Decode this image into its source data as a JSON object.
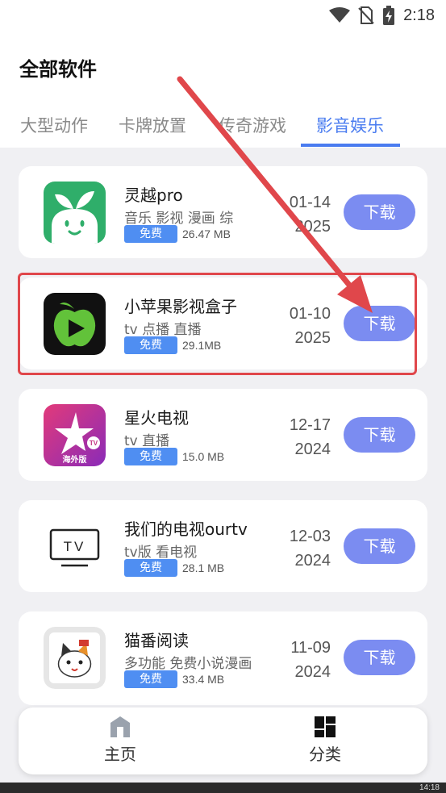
{
  "status_bar": {
    "time": "2:18"
  },
  "page": {
    "title": "全部软件"
  },
  "tabs": [
    {
      "label": "大型动作",
      "active": false
    },
    {
      "label": "卡牌放置",
      "active": false
    },
    {
      "label": "传奇游戏",
      "active": false
    },
    {
      "label": "影音娱乐",
      "active": true
    }
  ],
  "apps": [
    {
      "name": "灵越pro",
      "tags": "音乐 影视 漫画 综",
      "badge": "免费",
      "size": "26.47 MB",
      "date_top": "01-14",
      "date_bottom": "2025",
      "button": "下载",
      "icon": "leaf-face-icon"
    },
    {
      "name": "小苹果影视盒子",
      "tags": "tv 点播 直播",
      "badge": "免费",
      "size": "29.1MB",
      "date_top": "01-10",
      "date_bottom": "2025",
      "button": "下载",
      "icon": "apple-play-icon"
    },
    {
      "name": "星火电视",
      "tags": "tv 直播",
      "badge": "免费",
      "size": "15.0 MB",
      "date_top": "12-17",
      "date_bottom": "2024",
      "button": "下载",
      "icon": "star-tv-icon",
      "icon_text": "海外版",
      "icon_tv_text": "TV"
    },
    {
      "name": "我们的电视ourtv",
      "tags": "tv版 看电视",
      "badge": "免费",
      "size": "28.1 MB",
      "date_top": "12-03",
      "date_bottom": "2024",
      "button": "下载",
      "icon": "tv-outline-icon",
      "icon_text": "TV"
    },
    {
      "name": "猫番阅读",
      "tags": "多功能 免费小说漫画",
      "badge": "免费",
      "size": "33.4 MB",
      "date_top": "11-09",
      "date_bottom": "2024",
      "button": "下载",
      "icon": "cat-icon"
    }
  ],
  "bottom_nav": [
    {
      "label": "主页",
      "icon": "home-icon"
    },
    {
      "label": "分类",
      "icon": "category-icon"
    }
  ],
  "system_bar": {
    "time": "14:18"
  },
  "colors": {
    "accent": "#4a7cf0",
    "download_button": "#7b8cf1",
    "free_badge": "#4f8ef2",
    "annotation_red": "#e0474b"
  }
}
